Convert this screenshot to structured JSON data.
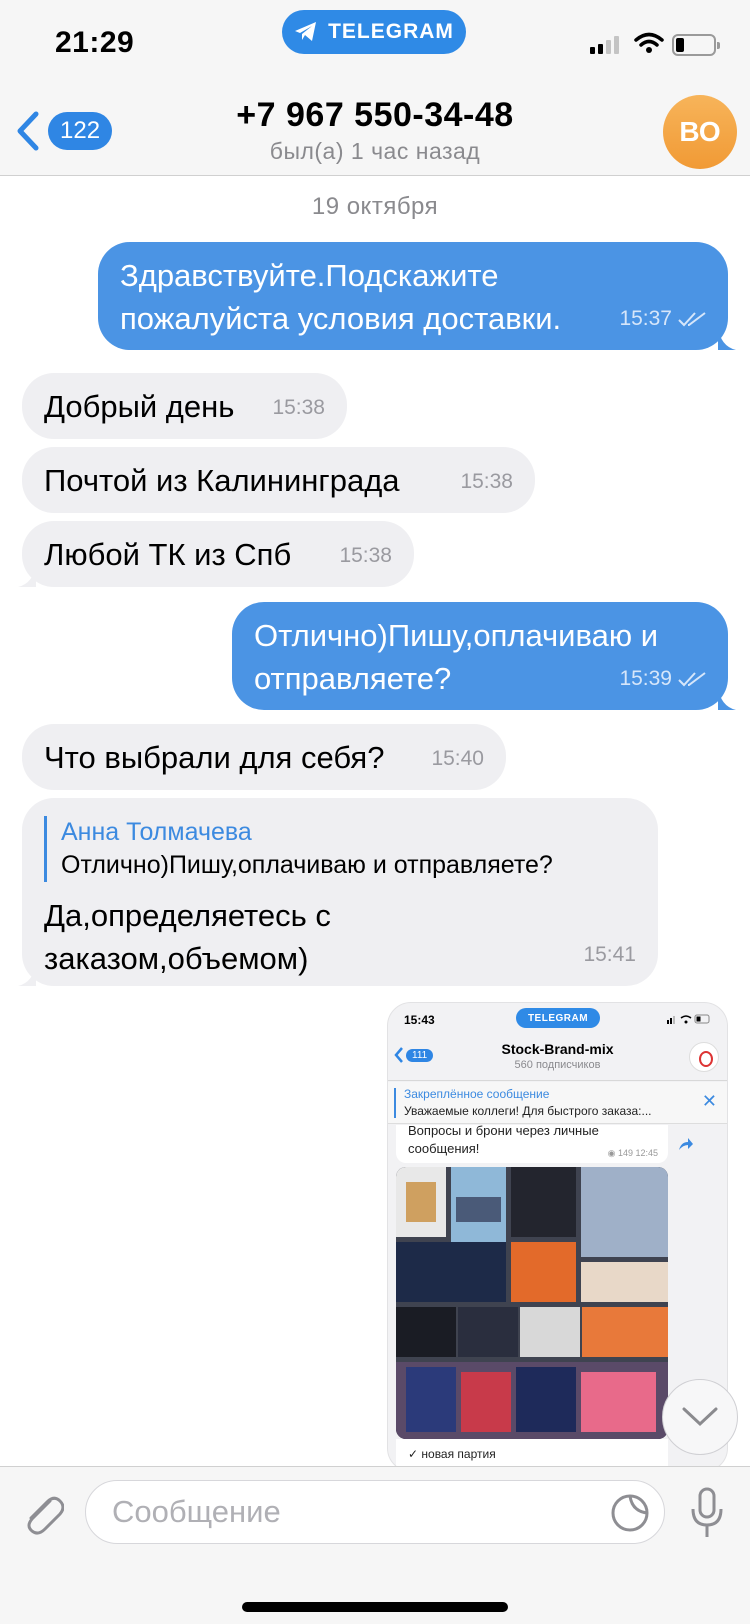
{
  "status_bar": {
    "time": "21:29",
    "app_pill": "TELEGRAM"
  },
  "header": {
    "back_count": "122",
    "title": "+7 967 550-34-48",
    "subtitle": "был(а) 1 час назад",
    "avatar_initials": "ВО"
  },
  "chat": {
    "date_separator": "19 октября",
    "messages": [
      {
        "direction": "out",
        "text": "Здравствуйте.Подскажите пожалуйста условия доставки.",
        "time": "15:37"
      },
      {
        "direction": "in",
        "text": "Добрый день",
        "time": "15:38"
      },
      {
        "direction": "in",
        "text": "Почтой из Калининграда",
        "time": "15:38"
      },
      {
        "direction": "in",
        "text": "Любой ТК из Спб",
        "time": "15:38"
      },
      {
        "direction": "out",
        "text": "Отлично)Пишу,оплачиваю и отправляете?",
        "time": "15:39"
      },
      {
        "direction": "in",
        "text": "Что выбрали для себя?",
        "time": "15:40"
      },
      {
        "direction": "in",
        "reply_to": {
          "name": "Анна Толмачева",
          "text": "Отлично)Пишу,оплачиваю и отправляете?"
        },
        "text": "Да,определяетесь с заказом,объемом)",
        "time": "15:41"
      }
    ],
    "screenshot": {
      "time": "15:43",
      "app_pill": "TELEGRAM",
      "back_count": "111",
      "channel_title": "Stock-Brand-mix",
      "channel_sub": "560 подписчиков",
      "pinned_title": "Закреплённое сообщение",
      "pinned_text": "Уважаемые коллеги! Для быстрого заказа:...",
      "message_text": "Вопросы и брони через личные сообщения!",
      "message_meta": "149 12:45",
      "caption": "✓ новая партия"
    }
  },
  "composer": {
    "placeholder": "Сообщение"
  },
  "colors": {
    "outgoing_bubble": "#4b94e4",
    "incoming_bubble": "#efeff2",
    "accent": "#2f86e4",
    "avatar": "#f3a643"
  },
  "icons": [
    "telegram-icon",
    "signal-icon",
    "wifi-icon",
    "battery-icon",
    "chevron-left-icon",
    "double-check-icon",
    "chevron-down-icon",
    "paperclip-icon",
    "sticker-icon",
    "microphone-icon",
    "share-icon"
  ]
}
